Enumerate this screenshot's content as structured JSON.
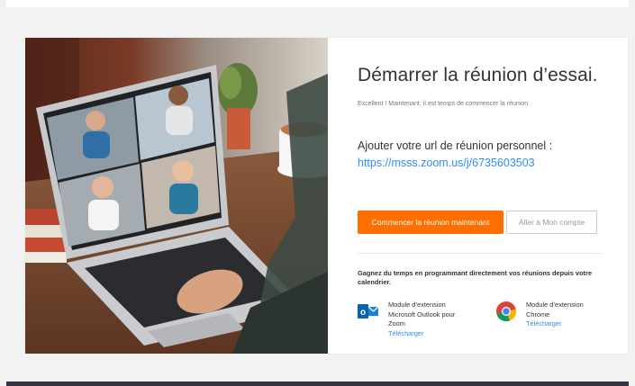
{
  "card": {
    "title": "Démarrer la réunion d’essai.",
    "subtitle": "Excellent ! Maintenant, il est temps de commencer la réunion.",
    "url_label": "Ajouter votre url de réunion personnel :",
    "url_link": "https://msss.zoom.us/j/6735603503",
    "start_button": "Commencer la réunion maintenant",
    "account_button": "Aller à Mon compte",
    "plugins_heading": "Gagnez du temps en programmant directement vos réunions depuis votre calendrier.",
    "plugins": [
      {
        "icon": "outlook-icon",
        "lines": [
          "Module d’extension",
          "Microsoft Outlook pour",
          "Zoom"
        ],
        "download": "Télécharger"
      },
      {
        "icon": "chrome-icon",
        "lines": [
          "Module d’extension",
          "Chrome"
        ],
        "download": "Télécharger"
      }
    ]
  },
  "colors": {
    "accent_orange": "#ff6f00",
    "link_blue": "#2d8cff",
    "footer_dark": "#33343f"
  }
}
